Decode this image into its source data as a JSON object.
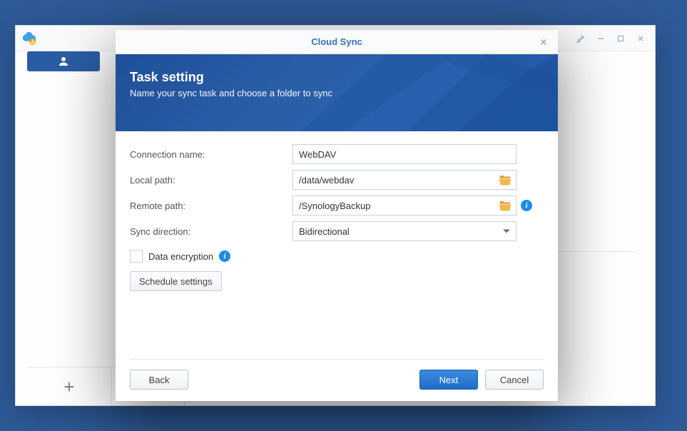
{
  "modal": {
    "title": "Cloud Sync",
    "hero": {
      "heading": "Task setting",
      "sub": "Name your sync task and choose a folder to sync"
    },
    "fields": {
      "connection_label": "Connection name:",
      "connection_value": "WebDAV",
      "local_label": "Local path:",
      "local_value": "/data/webdav",
      "remote_label": "Remote path:",
      "remote_value": "/SynologyBackup",
      "direction_label": "Sync direction:",
      "direction_value": "Bidirectional"
    },
    "encryption_label": "Data encryption",
    "schedule_button": "Schedule settings",
    "buttons": {
      "back": "Back",
      "next": "Next",
      "cancel": "Cancel"
    }
  }
}
